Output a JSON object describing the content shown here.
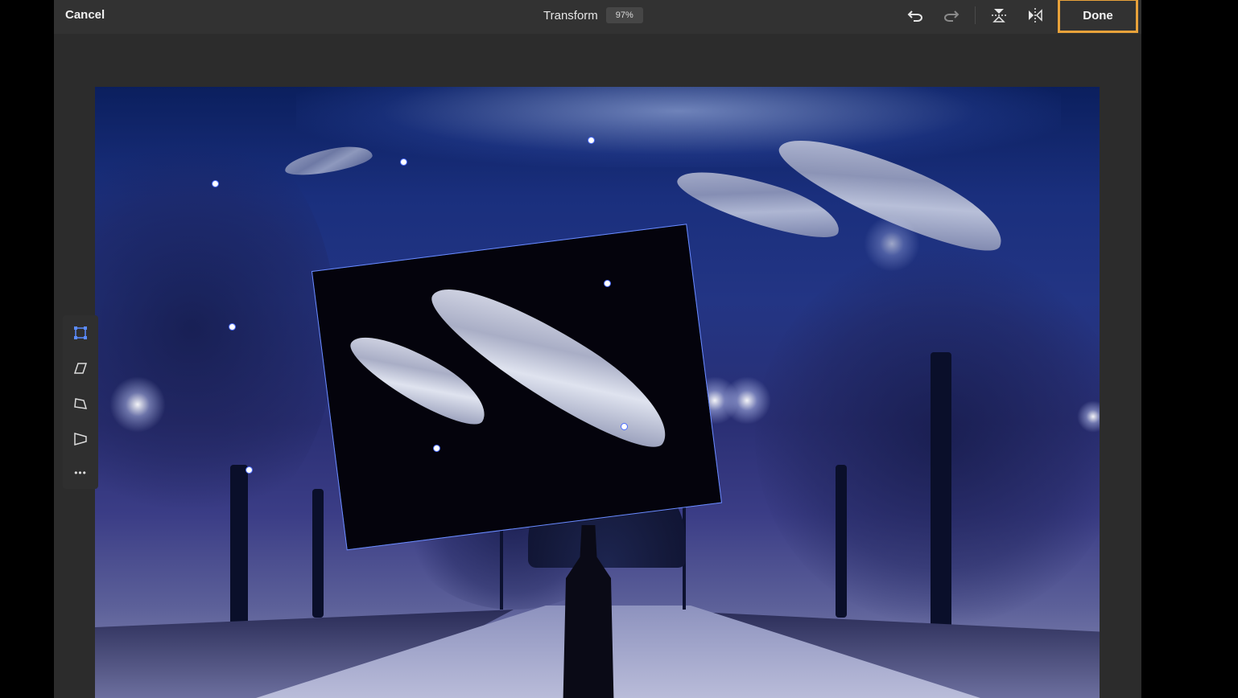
{
  "topbar": {
    "cancel_label": "Cancel",
    "title": "Transform",
    "zoom": "97%",
    "done_label": "Done",
    "icons": [
      "undo-icon",
      "redo-icon",
      "flip-vertical-icon",
      "flip-horizontal-icon"
    ]
  },
  "tools": {
    "items": [
      "free-transform-icon",
      "skew-icon",
      "distort-icon",
      "perspective-icon",
      "more-icon"
    ],
    "more_label": "•••"
  },
  "colors": {
    "accent": "#e8a23a",
    "selection": "#4a6cff",
    "toolbar_bg": "#323232",
    "app_bg": "#2c2c2c"
  }
}
